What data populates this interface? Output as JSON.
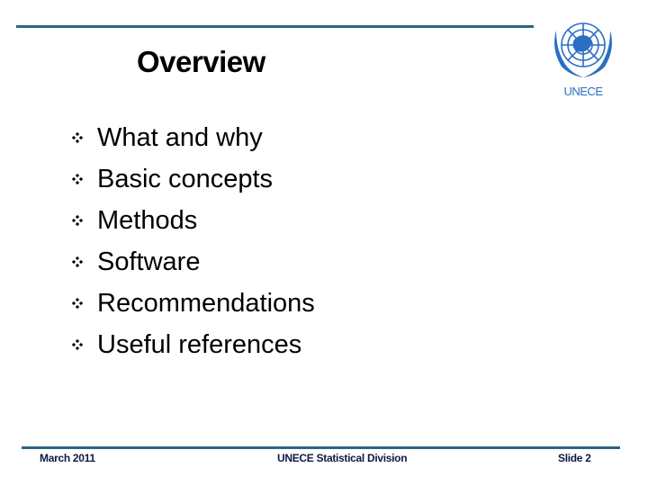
{
  "slide": {
    "title": "Overview",
    "logo_label": "UNECE",
    "bullets": [
      {
        "label": "What and why",
        "icon": "diamond-bullet-icon"
      },
      {
        "label": "Basic concepts",
        "icon": "diamond-bullet-icon"
      },
      {
        "label": "Methods",
        "icon": "diamond-bullet-icon"
      },
      {
        "label": "Software",
        "icon": "diamond-bullet-icon"
      },
      {
        "label": "Recommendations",
        "icon": "diamond-bullet-icon"
      },
      {
        "label": "Useful references",
        "icon": "diamond-bullet-icon"
      }
    ]
  },
  "footer": {
    "date": "March 2011",
    "organization": "UNECE Statistical Division",
    "slide_number": "Slide 2"
  },
  "colors": {
    "rule": "#2f6583",
    "logo_blue": "#2a6fc4",
    "footer_text": "#0f1a44"
  }
}
